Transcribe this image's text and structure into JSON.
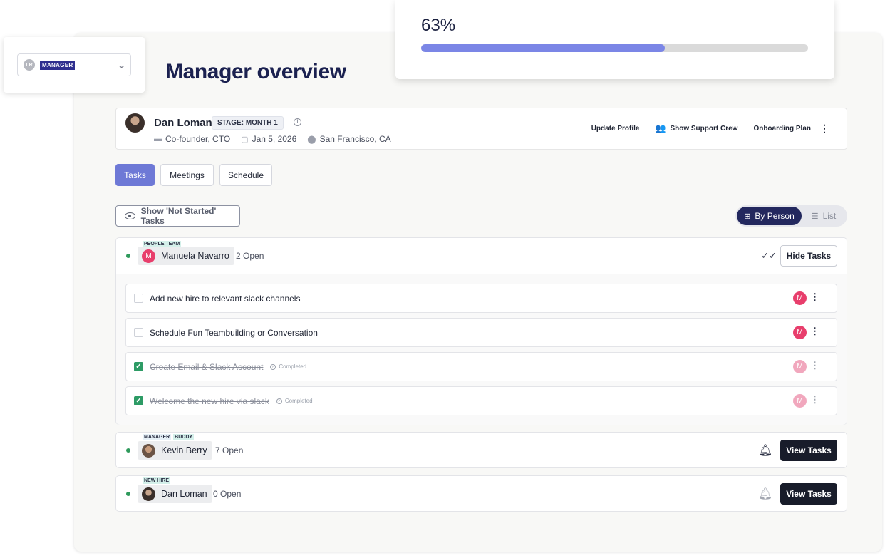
{
  "role_selector": {
    "initials": "LR",
    "role": "MANAGER"
  },
  "progress": {
    "label": "63%",
    "value": 0.63,
    "fill_color": "#7b86e6"
  },
  "page_title": "Manager overview",
  "profile": {
    "name": "Dan Loman",
    "stage": "STAGE: MONTH 1",
    "title": "Co-founder, CTO",
    "start_date": "Jan 5, 2026",
    "location": "San Francisco, CA",
    "actions": {
      "update_profile": "Update Profile",
      "show_support_crew": "Show Support Crew",
      "onboarding_plan": "Onboarding Plan"
    }
  },
  "tabs": [
    {
      "label": "Tasks",
      "active": true
    },
    {
      "label": "Meetings",
      "active": false
    },
    {
      "label": "Schedule",
      "active": false
    }
  ],
  "filter_button": "Show 'Not Started' Tasks",
  "view_switch": {
    "by_person": "By Person",
    "list": "List"
  },
  "groups": [
    {
      "tags": [
        "PEOPLE TEAM"
      ],
      "name": "Manuela Navarro",
      "avatar_initial": "M",
      "open_count": "2 Open",
      "button": "Hide Tasks",
      "tasks": [
        {
          "title": "Add new hire to relevant slack channels",
          "done": false
        },
        {
          "title": "Schedule Fun Teambuilding or Conversation",
          "done": false
        },
        {
          "title": "Create Email & Slack Account",
          "done": true,
          "status": "Completed"
        },
        {
          "title": "Welcome the new hire via slack",
          "done": true,
          "status": "Completed"
        }
      ]
    },
    {
      "tags": [
        "MANAGER",
        "BUDDY"
      ],
      "name": "Kevin Berry",
      "open_count": "7 Open",
      "button": "View Tasks"
    },
    {
      "tags": [
        "NEW HIRE"
      ],
      "name": "Dan Loman",
      "open_count": "0 Open",
      "button": "View Tasks"
    }
  ],
  "task_avatar_initial": "M",
  "colors": {
    "accent": "#6e79d6",
    "navy": "#23285e",
    "success": "#2d9b65",
    "avatar_pink": "#e83e6c"
  }
}
